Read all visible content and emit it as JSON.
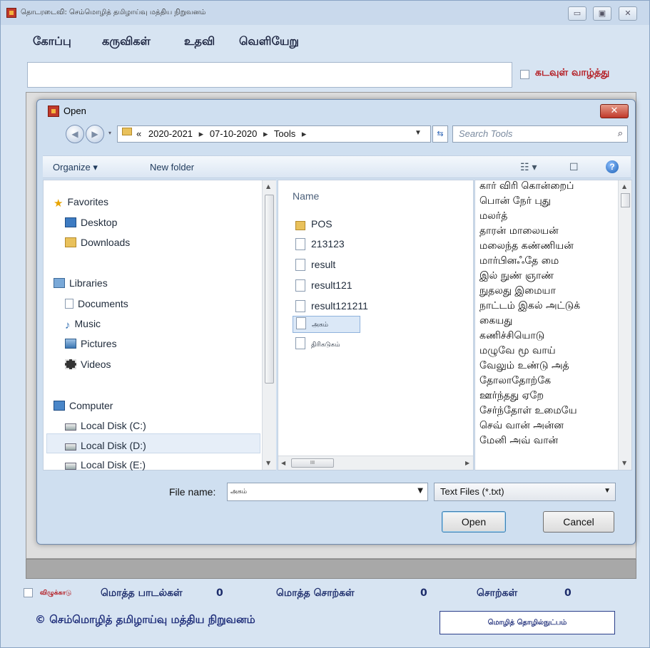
{
  "app": {
    "title": "தொடரடைவி: செம்மொழித் தமிழாய்வு மத்திய நிறுவனம்",
    "controls": [
      "minimize",
      "maximize",
      "close"
    ]
  },
  "menu": [
    "கோப்பு",
    "கருவிகள்",
    "உதவி",
    "வெளியேறு"
  ],
  "top": {
    "input_value": "",
    "kadavul_label": "கடவுள் வாழ்த்து",
    "kadavul_checked": false
  },
  "dialog": {
    "title": "Open",
    "breadcrumb": [
      "«",
      "2020-2021",
      "07-10-2020",
      "Tools"
    ],
    "search_placeholder": "Search Tools",
    "toolbar": {
      "organize": "Organize ▾",
      "new_folder": "New folder"
    },
    "nav": {
      "favorites": "Favorites",
      "desktop": "Desktop",
      "downloads": "Downloads",
      "libraries": "Libraries",
      "documents": "Documents",
      "music": "Music",
      "pictures": "Pictures",
      "videos": "Videos",
      "computer": "Computer",
      "disk_c": "Local Disk (C:)",
      "disk_d": "Local Disk (D:)",
      "disk_e": "Local Disk (E:)"
    },
    "column_header": "Name",
    "files": [
      {
        "name": "POS",
        "type": "folder"
      },
      {
        "name": "213123",
        "type": "file"
      },
      {
        "name": "result",
        "type": "file"
      },
      {
        "name": "result121",
        "type": "file"
      },
      {
        "name": "result121211",
        "type": "file"
      },
      {
        "name": "அகம்",
        "type": "file",
        "selected": true
      },
      {
        "name": "திரிகடுகம்",
        "type": "file"
      }
    ],
    "preview_lines": [
      "கார் விரி கொன்றைப்",
      "பொன் நேர் புது",
      "மலர்த்",
      "தாரன் மாலையன்",
      "மலைந்த கண்ணியன்",
      "மார்பினஃதே மை",
      "இல் நுண் ஞாண்",
      "நுதலது இமையா",
      "நாட்டம் இகல் அட்டுக்",
      "கையது",
      "கணிச்சியொடு",
      "மழுவே மூ வாய்",
      "வேலும் உண்டு அத்",
      "தோலாதோற்கே",
      "ஊர்ந்தது ஏறே",
      "சேர்ந்தோள் உமையே",
      "செவ் வான் அன்ன",
      "மேனி அவ் வான்"
    ],
    "file_name_label": "File name:",
    "file_name_value": "அகம்",
    "filter": "Text Files (*.txt)",
    "open_label": "Open",
    "cancel_label": "Cancel"
  },
  "bottom": {
    "checkbox_label": "விழுக்காடு",
    "total_songs_label": "மொத்த பாடல்கள்",
    "total_songs_value": "0",
    "total_words_label": "மொத்த சொற்கள்",
    "total_words_value": "0",
    "words_label": "சொற்கள்",
    "words_value": "0",
    "copyright": "© செம்மொழித் தமிழாய்வு மத்திய நிறுவனம்",
    "tech_label": "மொழித் தொழில்நுட்பம்"
  }
}
